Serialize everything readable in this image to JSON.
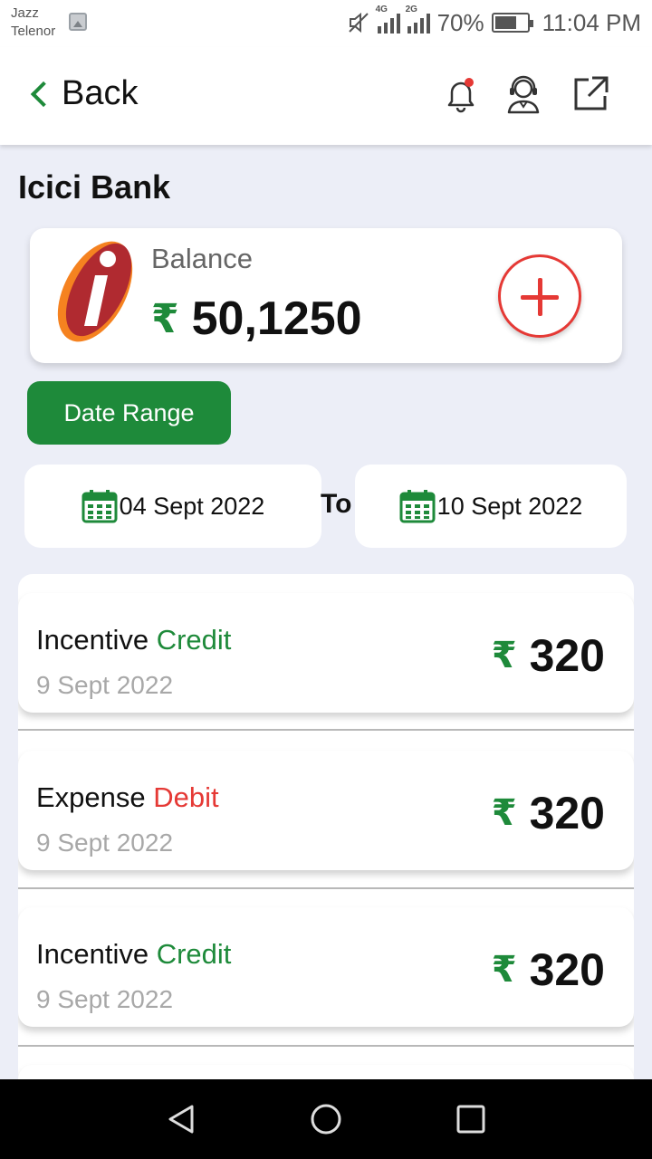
{
  "status_bar": {
    "carrier_line1": "Jazz",
    "carrier_line2": "Telenor",
    "net1": "4G",
    "net2": "2G",
    "battery": "70%",
    "battery_level": 0.7,
    "time": "11:04 PM"
  },
  "header": {
    "back_label": "Back",
    "icons": [
      "bell-icon",
      "support-agent-icon",
      "external-link-icon"
    ],
    "notification_dot_color": "#e53935"
  },
  "page_title": "Icici Bank",
  "balance": {
    "label": "Balance",
    "currency": "₹",
    "amount": "50,1250"
  },
  "date_range": {
    "button_label": "Date Range",
    "from": "04 Sept 2022",
    "to_label": "To",
    "to": "10 Sept 2022"
  },
  "transactions": [
    {
      "name": "Incentive",
      "type": "Credit",
      "date": "9 Sept 2022",
      "currency": "₹",
      "amount": "320"
    },
    {
      "name": "Expense",
      "type": "Debit",
      "date": "9 Sept 2022",
      "currency": "₹",
      "amount": "320"
    },
    {
      "name": "Incentive",
      "type": "Credit",
      "date": "9 Sept 2022",
      "currency": "₹",
      "amount": "320"
    }
  ],
  "colors": {
    "accent_green": "#1e8a3a",
    "debit_red": "#e53935",
    "background": "#eceef7"
  },
  "nav_bar": [
    "back-triangle-icon",
    "home-circle-icon",
    "recents-square-icon"
  ]
}
